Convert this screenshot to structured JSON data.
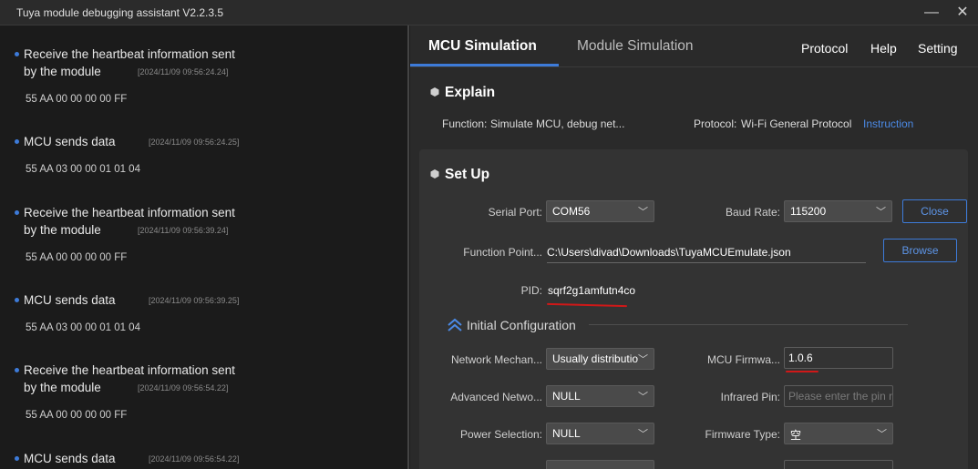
{
  "window": {
    "title": "Tuya module debugging assistant V2.2.3.5",
    "minimize_glyph": "—",
    "close_glyph": "✕"
  },
  "log": {
    "entries": [
      {
        "title_line1": "Receive the heartbeat information sent",
        "title_line2": "by the module",
        "timestamp": "[2024/11/09 09:56:24.24]",
        "hex": "55 AA 00 00 00 00 FF"
      },
      {
        "title_line1": "MCU sends data",
        "timestamp": "[2024/11/09 09:56:24.25]",
        "hex": "55 AA 03 00 00 01 01 04"
      },
      {
        "title_line1": "Receive the heartbeat information sent",
        "title_line2": "by the module",
        "timestamp": "[2024/11/09 09:56:39.24]",
        "hex": "55 AA 00 00 00 00 FF"
      },
      {
        "title_line1": "MCU sends data",
        "timestamp": "[2024/11/09 09:56:39.25]",
        "hex": "55 AA 03 00 00 01 01 04"
      },
      {
        "title_line1": "Receive the heartbeat information sent",
        "title_line2": "by the module",
        "timestamp": "[2024/11/09 09:56:54.22]",
        "hex": "55 AA 00 00 00 00 FF"
      },
      {
        "title_line1": "MCU sends data",
        "timestamp": "[2024/11/09 09:56:54.22]"
      }
    ]
  },
  "tabs": [
    {
      "label": "MCU Simulation",
      "active": true
    },
    {
      "label": "Module Simulation",
      "active": false
    }
  ],
  "menu": {
    "protocol": "Protocol",
    "help": "Help",
    "setting": "Setting"
  },
  "explain": {
    "heading": "Explain",
    "function_label": "Function:",
    "function_value": "Simulate MCU, debug net...",
    "protocol_label": "Protocol:",
    "protocol_value": "Wi-Fi General Protocol",
    "instruction_link": "Instruction"
  },
  "setup": {
    "heading": "Set Up",
    "serial_port_label": "Serial Port:",
    "serial_port_value": "COM56",
    "baud_rate_label": "Baud Rate:",
    "baud_rate_value": "115200",
    "close_button": "Close",
    "function_point_label": "Function Point...",
    "function_point_value": "C:\\Users\\divad\\Downloads\\TuyaMCUEmulate.json",
    "browse_button": "Browse",
    "pid_label": "PID:",
    "pid_value": "sqrf2g1amfutn4co"
  },
  "initial_config": {
    "heading": "Initial Configuration",
    "network_mechanism_label": "Network Mechan...",
    "network_mechanism_value": "Usually distributio",
    "mcu_firmware_label": "MCU Firmwa...",
    "mcu_firmware_value": "1.0.6",
    "advanced_network_label": "Advanced Netwo...",
    "advanced_network_value": "NULL",
    "infrared_pin_label": "Infrared Pin:",
    "infrared_pin_placeholder": "Please enter the pin nu",
    "power_selection_label": "Power Selection:",
    "power_selection_value": "NULL",
    "firmware_type_label": "Firmware Type:",
    "firmware_type_value": "空"
  },
  "colors": {
    "accent": "#3d7bd9",
    "annotation_red": "#d01818"
  }
}
